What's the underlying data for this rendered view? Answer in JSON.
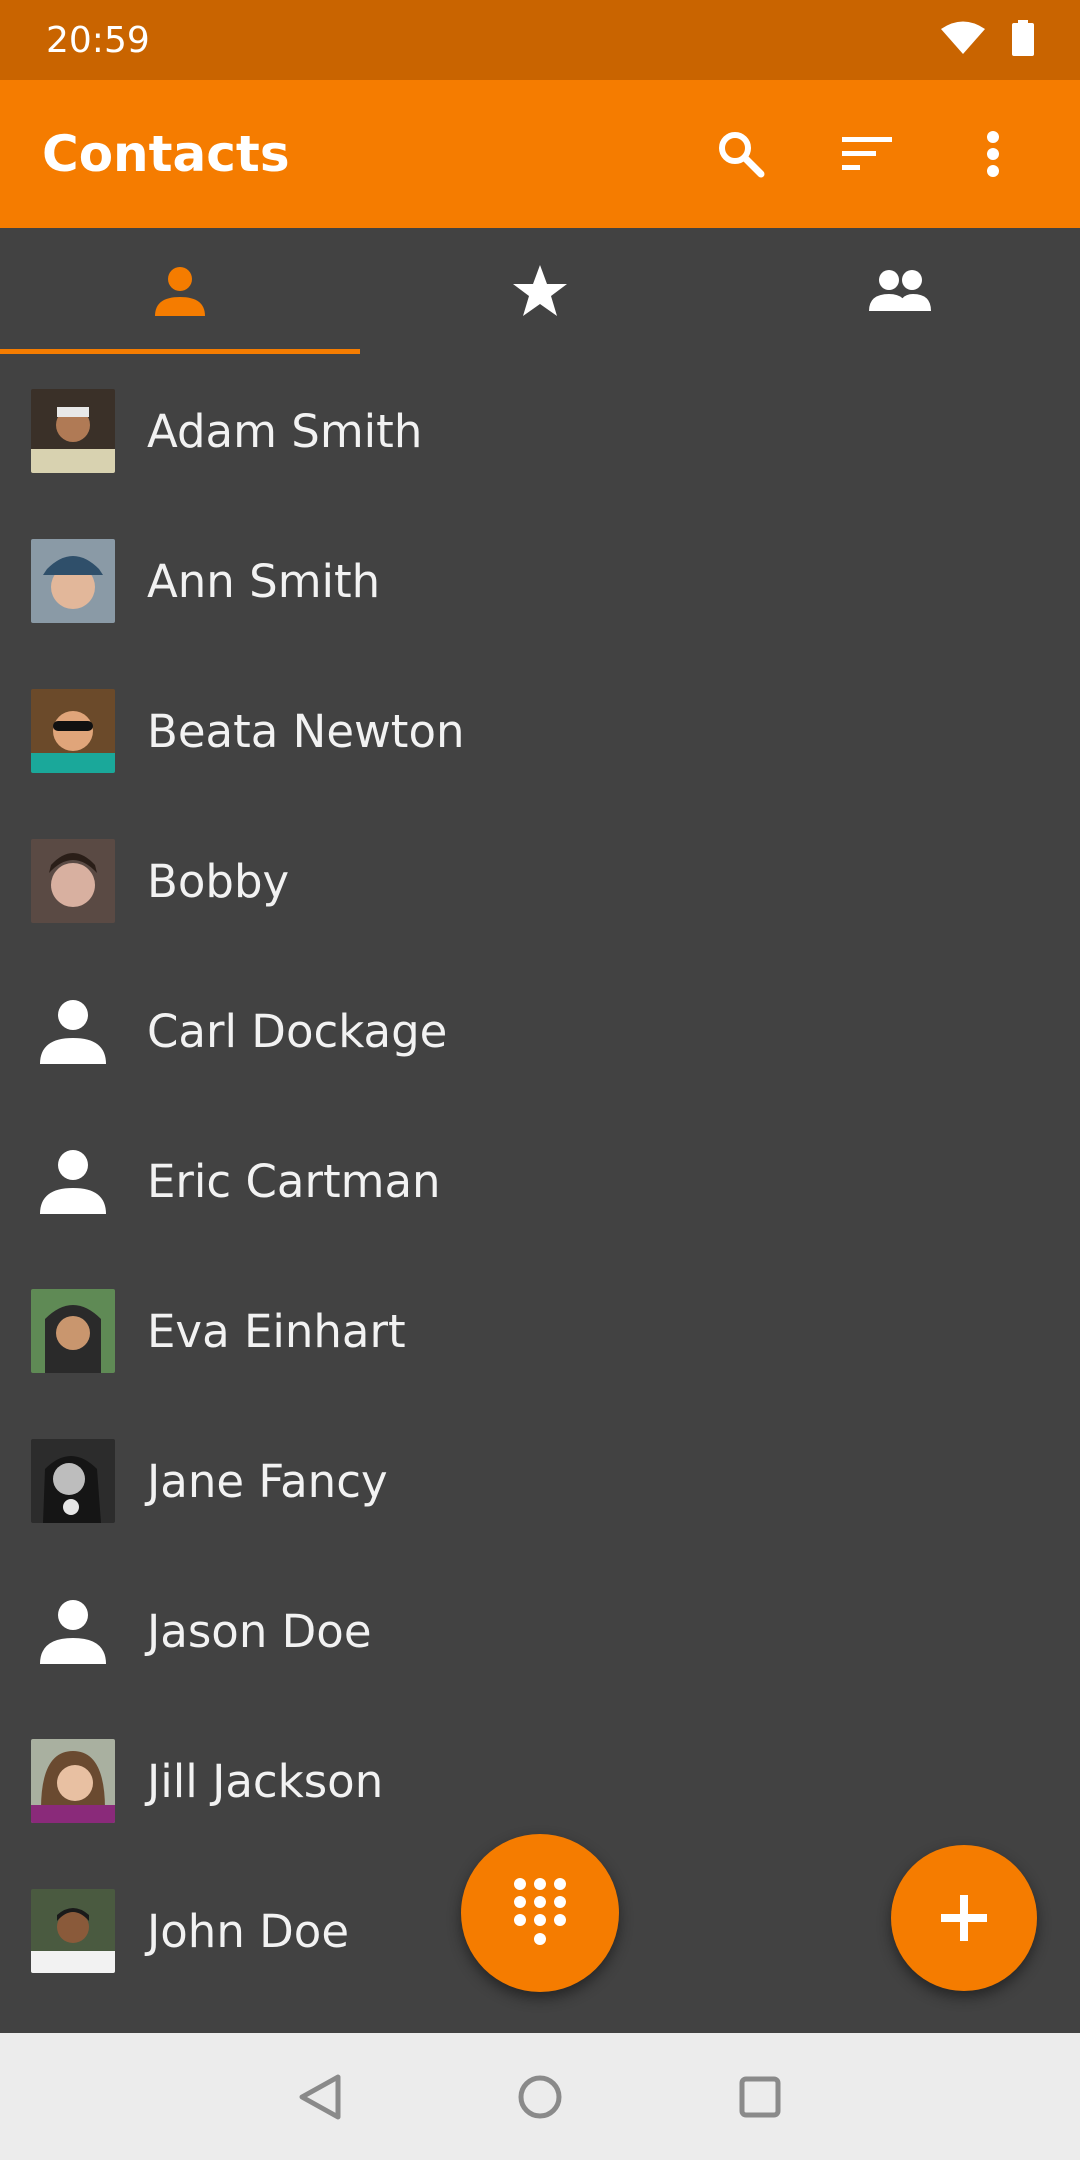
{
  "status_bar": {
    "time": "20:59",
    "icons": [
      "wifi-icon",
      "battery-icon"
    ]
  },
  "app_bar": {
    "title": "Contacts",
    "actions": [
      "search-icon",
      "sort-icon",
      "more-vert-icon"
    ]
  },
  "tabs": [
    {
      "icon": "person-icon",
      "active": true
    },
    {
      "icon": "star-icon",
      "active": false
    },
    {
      "icon": "group-icon",
      "active": false
    }
  ],
  "contacts": [
    {
      "name": "Adam Smith",
      "avatar": "photo"
    },
    {
      "name": "Ann Smith",
      "avatar": "photo"
    },
    {
      "name": "Beata Newton",
      "avatar": "photo"
    },
    {
      "name": "Bobby",
      "avatar": "photo"
    },
    {
      "name": "Carl Dockage",
      "avatar": "placeholder"
    },
    {
      "name": "Eric Cartman",
      "avatar": "placeholder"
    },
    {
      "name": "Eva Einhart",
      "avatar": "photo"
    },
    {
      "name": "Jane Fancy",
      "avatar": "photo"
    },
    {
      "name": "Jason Doe",
      "avatar": "placeholder"
    },
    {
      "name": "Jill Jackson",
      "avatar": "photo"
    },
    {
      "name": "John Doe",
      "avatar": "photo"
    }
  ],
  "fabs": [
    "dialpad-icon",
    "add-icon"
  ],
  "nav_bar": [
    "back-icon",
    "home-icon",
    "recents-icon"
  ],
  "colors": {
    "accent": "#f57c00",
    "status_bar": "#c96400",
    "background": "#424242",
    "nav_bar": "#ececec"
  }
}
